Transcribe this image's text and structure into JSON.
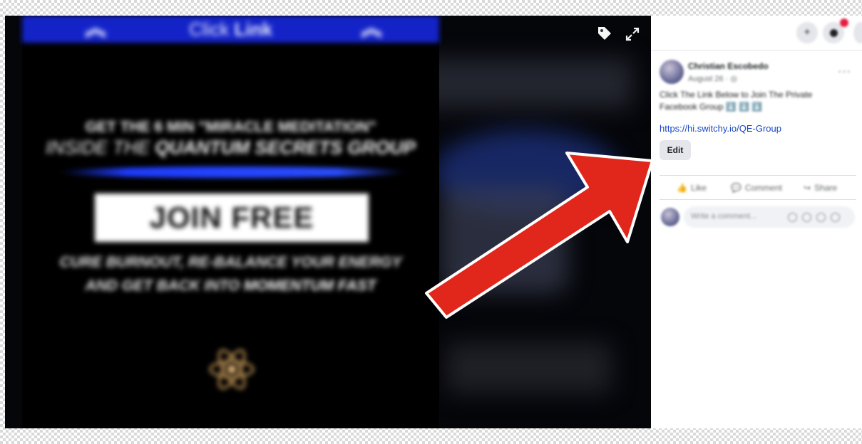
{
  "poster": {
    "banner_text_light": "Click ",
    "banner_text_bold": "Link",
    "headline_1": "GET THE 6 MIN  \"MIRACLE MEDITATION\"",
    "headline_2_light": "INSIDE THE ",
    "headline_2_bold": "QUANTUM SECRETS GROUP",
    "cta": "JOIN FREE",
    "sub_1": "CURE BURNOUT, RE-BALANCE YOUR ENERGY",
    "sub_2_light": "AND GET BACK INTO ",
    "sub_2_bold": "MOMENTUM FAST",
    "colors": {
      "banner": "#1423c8",
      "stripe": "#1e3cff",
      "emblem": "#c79a5a"
    }
  },
  "viewer_controls": {
    "tag_icon": "tag-icon",
    "expand_icon": "expand-icon"
  },
  "topbar": {
    "plus_icon": "+",
    "notifications_badge_color": "#e41e3f"
  },
  "post": {
    "author": "Christian Escobedo",
    "date": "August 26 · ",
    "caption": "Click The Link Below to Join The Private Facebook Group ⬇️ ⬇️ ⬇️",
    "link": "https://hi.switchy.io/QE-Group",
    "edit_label": "Edit",
    "more_label": "···"
  },
  "actions": {
    "like": "Like",
    "comment": "Comment",
    "share": "Share"
  },
  "comment_box": {
    "placeholder": "Write a comment..."
  },
  "annotation": {
    "arrow_color": "#e1261c"
  }
}
